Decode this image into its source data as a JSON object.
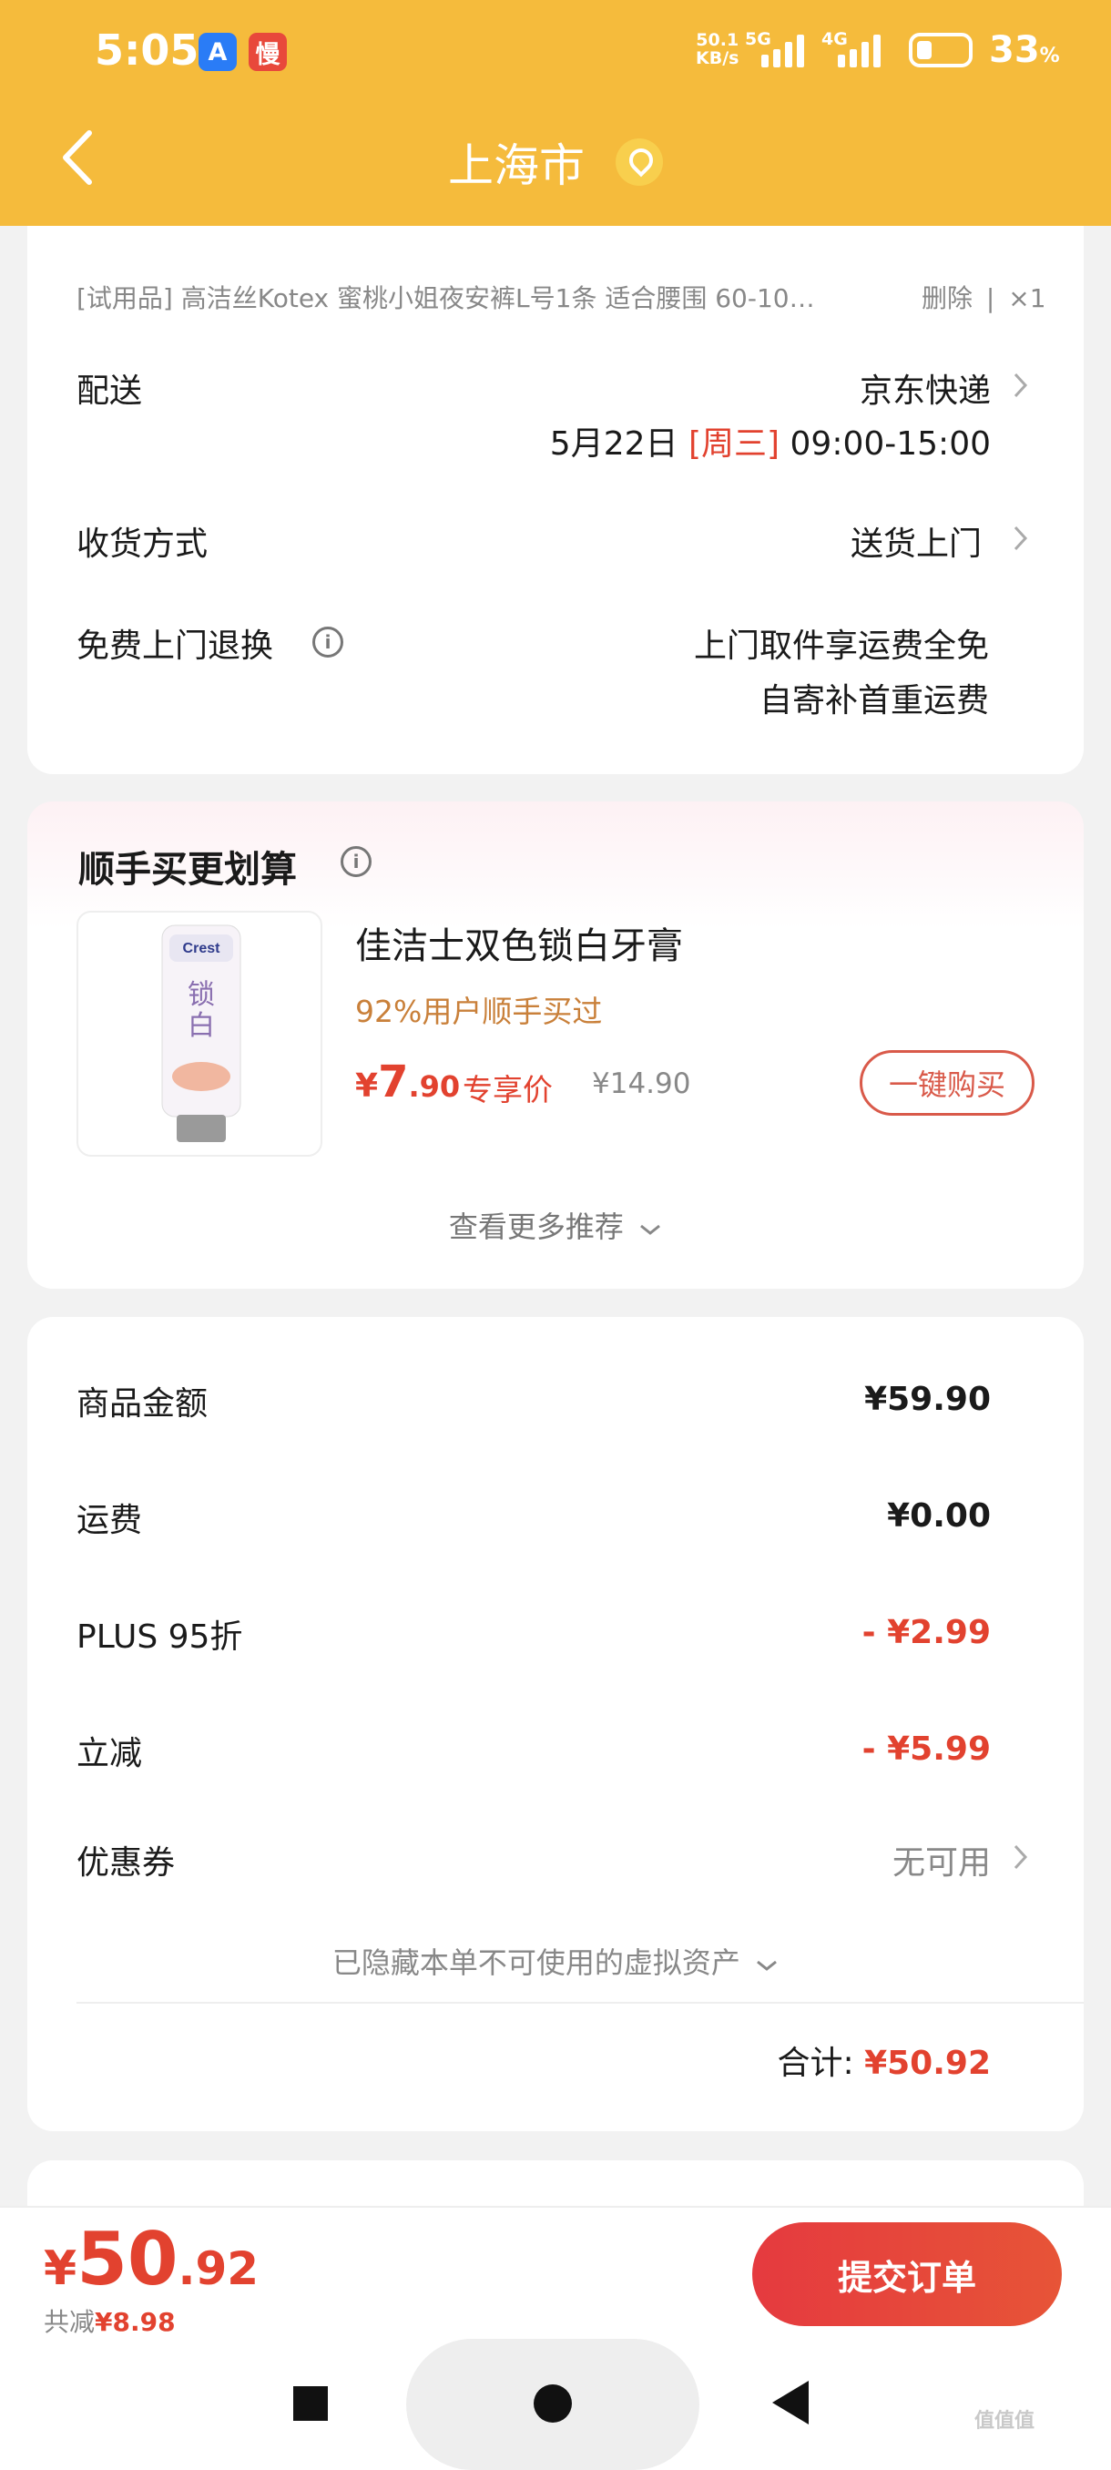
{
  "status_bar": {
    "time": "5:05",
    "app_icons": [
      {
        "name": "app-store-icon",
        "glyph": "A",
        "color": "#2a7cf6"
      },
      {
        "name": "slow-app-icon",
        "glyph": "慢",
        "color": "#e8483b"
      }
    ],
    "net_speed_value": "50.1",
    "net_speed_unit": "KB/s",
    "sig1_label": "5G",
    "sig2_label": "4G",
    "battery": "33",
    "battery_unit": "%"
  },
  "header": {
    "title": "上海市",
    "accent_color": "#f5bb3c"
  },
  "delivery": {
    "trial_item": "[试用品]  高洁丝Kotex 蜜桃小姐夜安裤L号1条  适合腰围 60-10…",
    "trial_delete": "删除",
    "trial_sep": "|",
    "trial_qty": "×1",
    "shipping_label": "配送",
    "shipping_value": "京东快递",
    "date_prefix": "5月22日",
    "date_day": "[周三]",
    "date_time": "09:00-15:00",
    "receive_label": "收货方式",
    "receive_value": "送货上门",
    "return_label": "免费上门退换",
    "return_line1": "上门取件享运费全免",
    "return_line2": "自寄补首重运费"
  },
  "recommend": {
    "title": "顺手买更划算",
    "product_name": "佳洁士双色锁白牙膏",
    "hint": "92%用户顺手买过",
    "price_yen": "¥",
    "price_int": "7",
    "price_dec": ".90",
    "price_tag": "专享价",
    "original_price": "¥14.90",
    "buy_button": "一键购买",
    "see_more": "查看更多推荐"
  },
  "fees": {
    "rows": [
      {
        "label": "商品金额",
        "value": "¥59.90"
      },
      {
        "label": "运费",
        "value": "¥0.00"
      },
      {
        "label": "PLUS 95折",
        "value": "- ¥2.99"
      },
      {
        "label": "立减",
        "value": "- ¥5.99"
      }
    ],
    "coupon_label": "优惠券",
    "coupon_value": "无可用",
    "hidden_assets": "已隐藏本单不可使用的虚拟资产",
    "total_label": "合计:",
    "total_value": "¥50.92"
  },
  "bottom": {
    "price_yen": "¥",
    "price_int": "50",
    "price_dec": ".92",
    "saved_label": "共减",
    "saved_value": "¥8.98",
    "submit_button": "提交订单"
  },
  "watermark": "值值值"
}
